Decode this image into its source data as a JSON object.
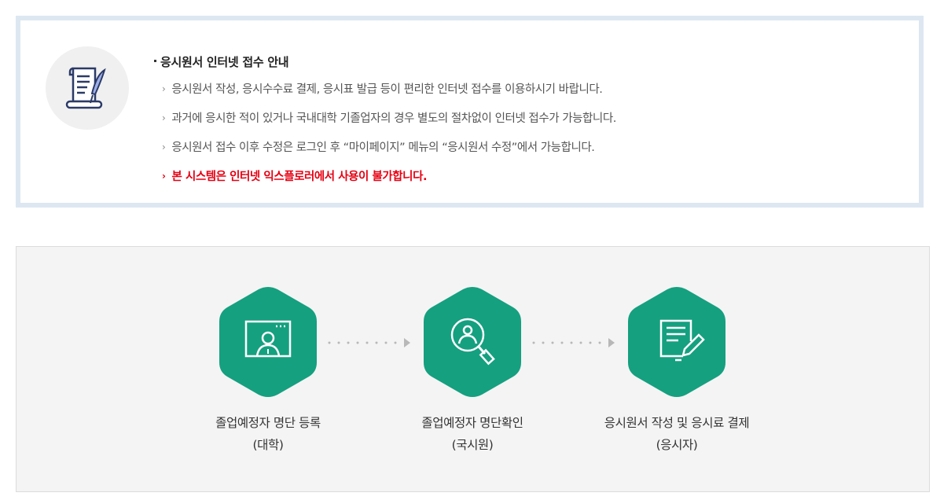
{
  "notice": {
    "icon": "document-scroll-pen-icon",
    "title": "응시원서 인터넷 접수 안내",
    "items": [
      "응시원서 작성, 응시수수료 결제, 응시표 발급 등이 편리한 인터넷 접수를 이용하시기 바랍니다.",
      "과거에 응시한 적이 있거나 국내대학 기졸업자의 경우 별도의 절차없이 인터넷 접수가 가능합니다.",
      "응시원서 접수 이후 수정은 로그인 후 “마이페이지” 메뉴의 “응시원서 수정”에서 가능합니다."
    ],
    "warning": "본 시스템은 인터넷 익스플로러에서 사용이 불가합니다.",
    "arrow_glyph": "›",
    "colors": {
      "border": "#dde7f1",
      "warning": "#e60012"
    }
  },
  "process": {
    "accent_color": "#15a080",
    "steps": [
      {
        "icon": "monitor-user-icon",
        "label": "졸업예정자 명단 등록",
        "sub": "(대학)"
      },
      {
        "icon": "magnifier-user-icon",
        "label": "졸업예정자 명단확인",
        "sub": "(국시원)"
      },
      {
        "icon": "document-pen-icon",
        "label": "응시원서 작성 및 응시료 결제",
        "sub": "(응시자)"
      }
    ]
  }
}
